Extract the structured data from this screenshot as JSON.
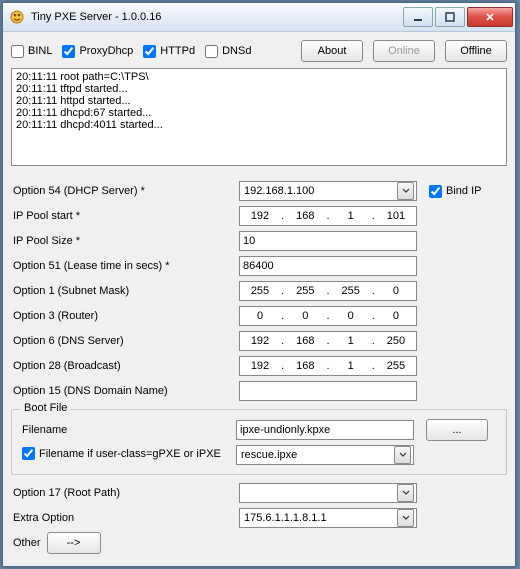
{
  "window": {
    "title": "Tiny PXE Server - 1.0.0.16"
  },
  "topbar": {
    "binl_label": "BINL",
    "binl_checked": false,
    "proxy_label": "ProxyDhcp",
    "proxy_checked": true,
    "httpd_label": "HTTPd",
    "httpd_checked": true,
    "dnsd_label": "DNSd",
    "dnsd_checked": false,
    "about": "About",
    "online": "Online",
    "offline": "Offline"
  },
  "log": "20:11:11 root path=C:\\TPS\\\n20:11:11 tftpd started...\n20:11:11 httpd started...\n20:11:11 dhcpd:67 started...\n20:11:11 dhcpd:4011 started...",
  "labels": {
    "opt54": "Option 54 (DHCP Server) *",
    "pool_start": "IP Pool start *",
    "pool_size": "IP Pool Size *",
    "opt51": "Option 51 (Lease time in secs) *",
    "opt1": "Option 1  (Subnet Mask)",
    "opt3": "Option 3  (Router)",
    "opt6": "Option 6  (DNS Server)",
    "opt28": "Option 28 (Broadcast)",
    "opt15": "Option 15 (DNS Domain Name)",
    "bootfile_group": "Boot File",
    "filename": "Filename",
    "alt_filename": "Filename if user-class=gPXE or iPXE",
    "opt17": "Option 17 (Root Path)",
    "extra": "Extra Option",
    "other": "Other",
    "bind_ip": "Bind IP",
    "browse": "...",
    "other_btn": "-->"
  },
  "values": {
    "opt54": "192.168.1.100",
    "bind_ip_checked": true,
    "pool_start": {
      "a": "192",
      "b": "168",
      "c": "1",
      "d": "101"
    },
    "pool_size": "10",
    "opt51": "86400",
    "opt1": {
      "a": "255",
      "b": "255",
      "c": "255",
      "d": "0"
    },
    "opt3": {
      "a": "0",
      "b": "0",
      "c": "0",
      "d": "0"
    },
    "opt6": {
      "a": "192",
      "b": "168",
      "c": "1",
      "d": "250"
    },
    "opt28": {
      "a": "192",
      "b": "168",
      "c": "1",
      "d": "255"
    },
    "opt15": "",
    "filename": "ipxe-undionly.kpxe",
    "alt_checked": true,
    "alt_filename": "rescue.ipxe",
    "opt17": "",
    "extra": "175.6.1.1.1.8.1.1"
  }
}
